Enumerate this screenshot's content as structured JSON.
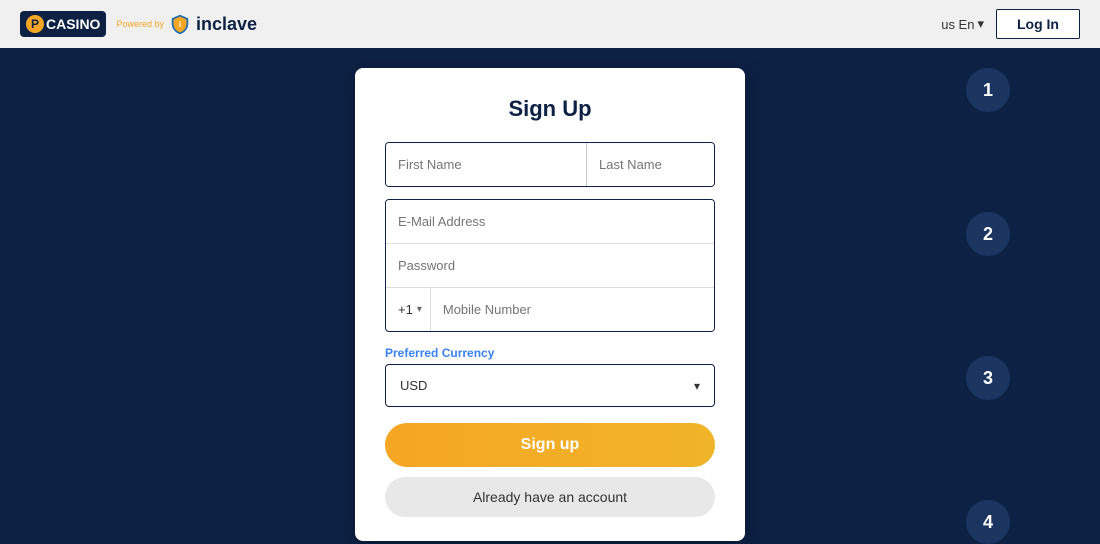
{
  "header": {
    "logo": {
      "p_letter": "P",
      "casino_text": "CASINO",
      "powered_by": "Powered by",
      "inclave_text": "inclave"
    },
    "lang": "us En",
    "login_label": "Log In"
  },
  "steps": [
    {
      "number": "1"
    },
    {
      "number": "2"
    },
    {
      "number": "3"
    },
    {
      "number": "4"
    }
  ],
  "form": {
    "title": "Sign Up",
    "first_name_placeholder": "First Name",
    "last_name_placeholder": "Last Name",
    "email_placeholder": "E-Mail Address",
    "password_placeholder": "Password",
    "phone_prefix": "+1",
    "phone_placeholder": "Mobile Number",
    "currency_label": "Preferred Currency",
    "currency_value": "USD",
    "signup_button": "Sign up",
    "already_account": "Already have an account"
  }
}
